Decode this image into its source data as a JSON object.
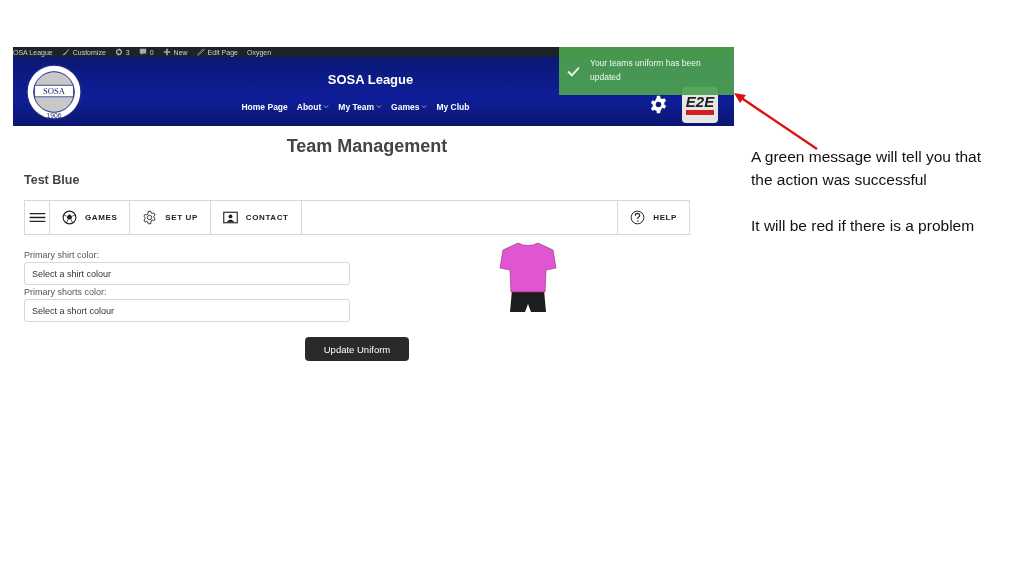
{
  "admin_bar": {
    "items": [
      {
        "kind": "site",
        "label": "OSA League"
      },
      {
        "kind": "brush",
        "label": "Customize"
      },
      {
        "kind": "updates",
        "label": "3"
      },
      {
        "kind": "comments",
        "label": "0"
      },
      {
        "kind": "plus",
        "label": "New"
      },
      {
        "kind": "pencil",
        "label": "Edit Page"
      },
      {
        "kind": "plain",
        "label": "Oxygen"
      }
    ]
  },
  "header": {
    "site_title": "SOSA League",
    "logo_text": "SOSA",
    "logo_year": "1906",
    "brand_text": "E2E",
    "nav": [
      {
        "label": "Home Page",
        "dropdown": false
      },
      {
        "label": "About",
        "dropdown": true
      },
      {
        "label": "My Team",
        "dropdown": true
      },
      {
        "label": "Games",
        "dropdown": true
      },
      {
        "label": "My Club",
        "dropdown": false
      }
    ]
  },
  "toast": {
    "kind": "success",
    "message": "Your teams uniform has been updated"
  },
  "page": {
    "title": "Team Management",
    "team_name": "Test Blue",
    "tabs": [
      {
        "kind": "menu"
      },
      {
        "kind": "ball",
        "label": "GAMES"
      },
      {
        "kind": "gear",
        "label": "SET UP"
      },
      {
        "kind": "contact",
        "label": "CONTACT"
      },
      {
        "kind": "help",
        "label": "HELP"
      }
    ],
    "fields": [
      {
        "label": "Primary shirt color:",
        "placeholder": "Select a shirt colour"
      },
      {
        "label": "Primary shorts color:",
        "placeholder": "Select a short colour"
      }
    ],
    "submit": "Update Uniform"
  },
  "annotation": {
    "lines": [
      "A green message will tell you that the action was successful",
      "It will be red if there is a problem"
    ]
  }
}
